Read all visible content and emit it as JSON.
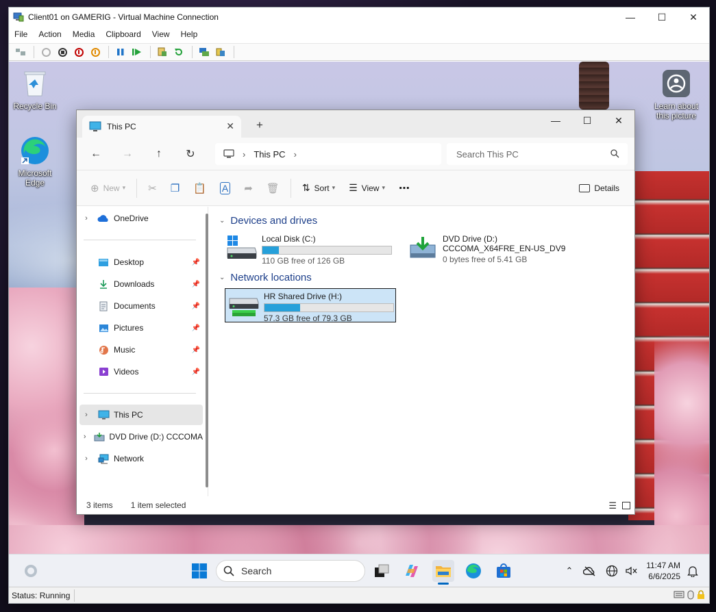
{
  "vm": {
    "title": "Client01 on GAMERIG - Virtual Machine Connection",
    "menu": [
      "File",
      "Action",
      "Media",
      "Clipboard",
      "View",
      "Help"
    ],
    "status": "Status: Running"
  },
  "desktop": {
    "icons": [
      {
        "label": "Recycle Bin",
        "icon": "recycle-bin-icon"
      },
      {
        "label": "Microsoft Edge",
        "icon": "edge-icon"
      },
      {
        "label": "Learn about this picture",
        "icon": "camera-info-icon"
      }
    ]
  },
  "explorer": {
    "tab_label": "This PC",
    "breadcrumb": [
      "This PC"
    ],
    "search_placeholder": "Search This PC",
    "commands": {
      "new": "New",
      "sort": "Sort",
      "view": "View",
      "details": "Details"
    },
    "sidebar": {
      "onedrive": "OneDrive",
      "quick": [
        {
          "label": "Desktop",
          "icon": "desktop-folder-icon"
        },
        {
          "label": "Downloads",
          "icon": "downloads-icon"
        },
        {
          "label": "Documents",
          "icon": "documents-icon"
        },
        {
          "label": "Pictures",
          "icon": "pictures-icon"
        },
        {
          "label": "Music",
          "icon": "music-icon"
        },
        {
          "label": "Videos",
          "icon": "videos-icon"
        }
      ],
      "this_pc": "This PC",
      "dvd": "DVD Drive (D:) CCCOMA",
      "network": "Network"
    },
    "groups": {
      "devices": "Devices and drives",
      "network": "Network locations"
    },
    "drives": {
      "c": {
        "name": "Local Disk (C:)",
        "free": "110 GB free of 126 GB",
        "used_fraction": 0.127
      },
      "d": {
        "name": "DVD Drive (D:)",
        "label": "CCCOMA_X64FRE_EN-US_DV9",
        "free": "0 bytes free of 5.41 GB"
      },
      "h": {
        "name": "HR Shared Drive (H:)",
        "free": "57.3 GB free of 79.3 GB",
        "used_fraction": 0.277
      }
    },
    "status": {
      "items": "3 items",
      "selected": "1 item selected"
    }
  },
  "taskbar": {
    "search_label": "Search",
    "time": "11:47 AM",
    "date": "6/6/2025"
  }
}
